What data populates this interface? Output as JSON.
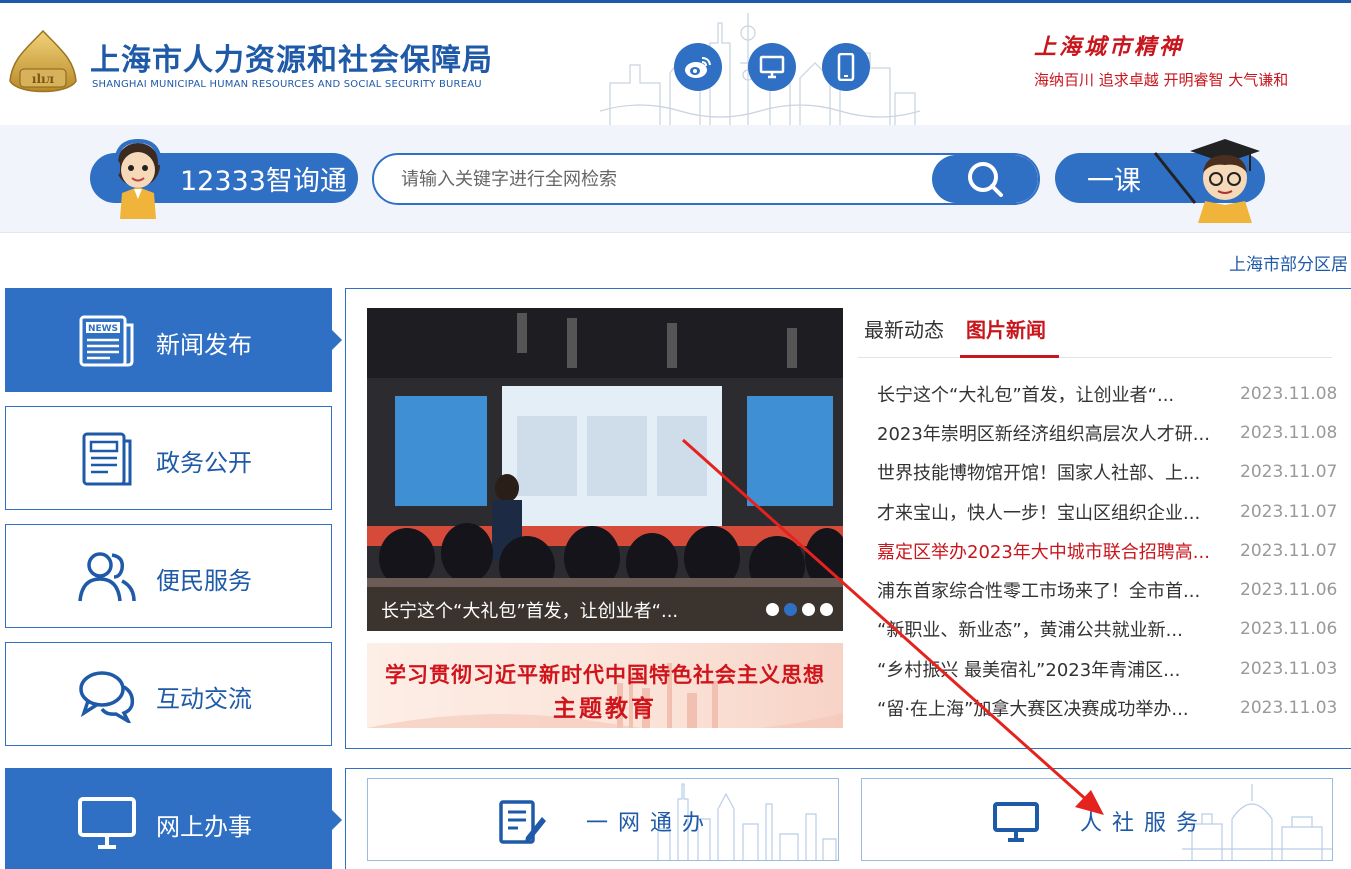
{
  "header": {
    "site_title": "上海市人力资源和社会保障局",
    "site_subtitle": "SHANGHAI MUNICIPAL HUMAN RESOURCES AND SOCIAL SECURITY BUREAU",
    "icons": [
      "weibo-icon",
      "monitor-icon",
      "mobile-icon"
    ],
    "spirit_title": "上海城市精神",
    "spirit_text": "海纳百川  追求卓越  开明睿智  大气谦和"
  },
  "search": {
    "assistant_label": "12333智询通",
    "placeholder": "请输入关键字进行全网检索",
    "course_label": "一课"
  },
  "notice": "上海市部分区居",
  "nav": [
    {
      "label": "新闻发布",
      "icon": "news-icon",
      "active": true
    },
    {
      "label": "政务公开",
      "icon": "document-icon",
      "active": false
    },
    {
      "label": "便民服务",
      "icon": "people-icon",
      "active": false
    },
    {
      "label": "互动交流",
      "icon": "chat-icon",
      "active": false
    },
    {
      "label": "网上办事",
      "icon": "computer-icon",
      "active": true
    }
  ],
  "carousel": {
    "caption": "长宁这个“大礼包”首发，让创业者“...",
    "slide_count": 4,
    "current_slide": 2
  },
  "banner": {
    "line1": "学习贯彻习近平新时代中国特色社会主义思想",
    "line2": "主题教育"
  },
  "tabs": {
    "latest": "最新动态",
    "photo_news": "图片新闻"
  },
  "news": [
    {
      "title": "长宁这个“大礼包”首发，让创业者“...",
      "date": "2023.11.08",
      "highlight": false
    },
    {
      "title": "2023年崇明区新经济组织高层次人才研...",
      "date": "2023.11.08",
      "highlight": false
    },
    {
      "title": "世界技能博物馆开馆！国家人社部、上...",
      "date": "2023.11.07",
      "highlight": false
    },
    {
      "title": "才来宝山，快人一步！宝山区组织企业...",
      "date": "2023.11.07",
      "highlight": false
    },
    {
      "title": "嘉定区举办2023年大中城市联合招聘高...",
      "date": "2023.11.07",
      "highlight": true
    },
    {
      "title": "浦东首家综合性零工市场来了！全市首...",
      "date": "2023.11.06",
      "highlight": false
    },
    {
      "title": "“新职业、新业态”，黄浦公共就业新...",
      "date": "2023.11.06",
      "highlight": false
    },
    {
      "title": "“乡村振兴 最美宿礼”2023年青浦区...",
      "date": "2023.11.03",
      "highlight": false
    },
    {
      "title": "“留·在上海”加拿大赛区决赛成功举办...",
      "date": "2023.11.03",
      "highlight": false
    }
  ],
  "services": [
    {
      "label": "一网通办",
      "icon": "form-edit-icon"
    },
    {
      "label": "人社服务",
      "icon": "desktop-icon"
    }
  ],
  "colors": {
    "primary": "#2f6fc4",
    "dark_blue": "#1f5aa8",
    "red": "#c8161d",
    "annotation_arrow": "#e5231e"
  }
}
